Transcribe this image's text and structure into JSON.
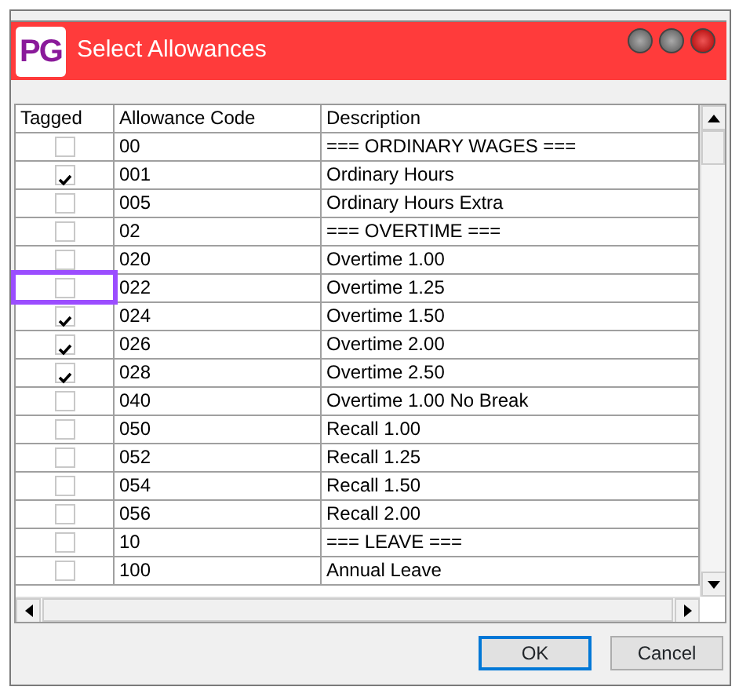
{
  "window": {
    "logo": "PG",
    "title": "Select Allowances"
  },
  "table": {
    "columns": [
      "Tagged",
      "Allowance Code",
      "Description"
    ],
    "rows": [
      {
        "tagged": false,
        "code": "00",
        "description": "=== ORDINARY WAGES ==="
      },
      {
        "tagged": true,
        "code": "001",
        "description": "Ordinary Hours"
      },
      {
        "tagged": false,
        "code": "005",
        "description": "Ordinary Hours Extra"
      },
      {
        "tagged": false,
        "code": "02",
        "description": "=== OVERTIME ==="
      },
      {
        "tagged": false,
        "code": "020",
        "description": "Overtime 1.00"
      },
      {
        "tagged": false,
        "code": "022",
        "description": "Overtime 1.25",
        "highlighted": true
      },
      {
        "tagged": true,
        "code": "024",
        "description": "Overtime 1.50"
      },
      {
        "tagged": true,
        "code": "026",
        "description": "Overtime 2.00"
      },
      {
        "tagged": true,
        "code": "028",
        "description": "Overtime 2.50"
      },
      {
        "tagged": false,
        "code": "040",
        "description": "Overtime 1.00 No Break"
      },
      {
        "tagged": false,
        "code": "050",
        "description": "Recall 1.00"
      },
      {
        "tagged": false,
        "code": "052",
        "description": "Recall 1.25"
      },
      {
        "tagged": false,
        "code": "054",
        "description": "Recall 1.50"
      },
      {
        "tagged": false,
        "code": "056",
        "description": "Recall 2.00"
      },
      {
        "tagged": false,
        "code": "10",
        "description": "=== LEAVE ==="
      },
      {
        "tagged": false,
        "code": "100",
        "description": "Annual Leave"
      }
    ]
  },
  "buttons": [
    {
      "label": "OK",
      "default": true
    },
    {
      "label": "Cancel",
      "default": false
    }
  ]
}
